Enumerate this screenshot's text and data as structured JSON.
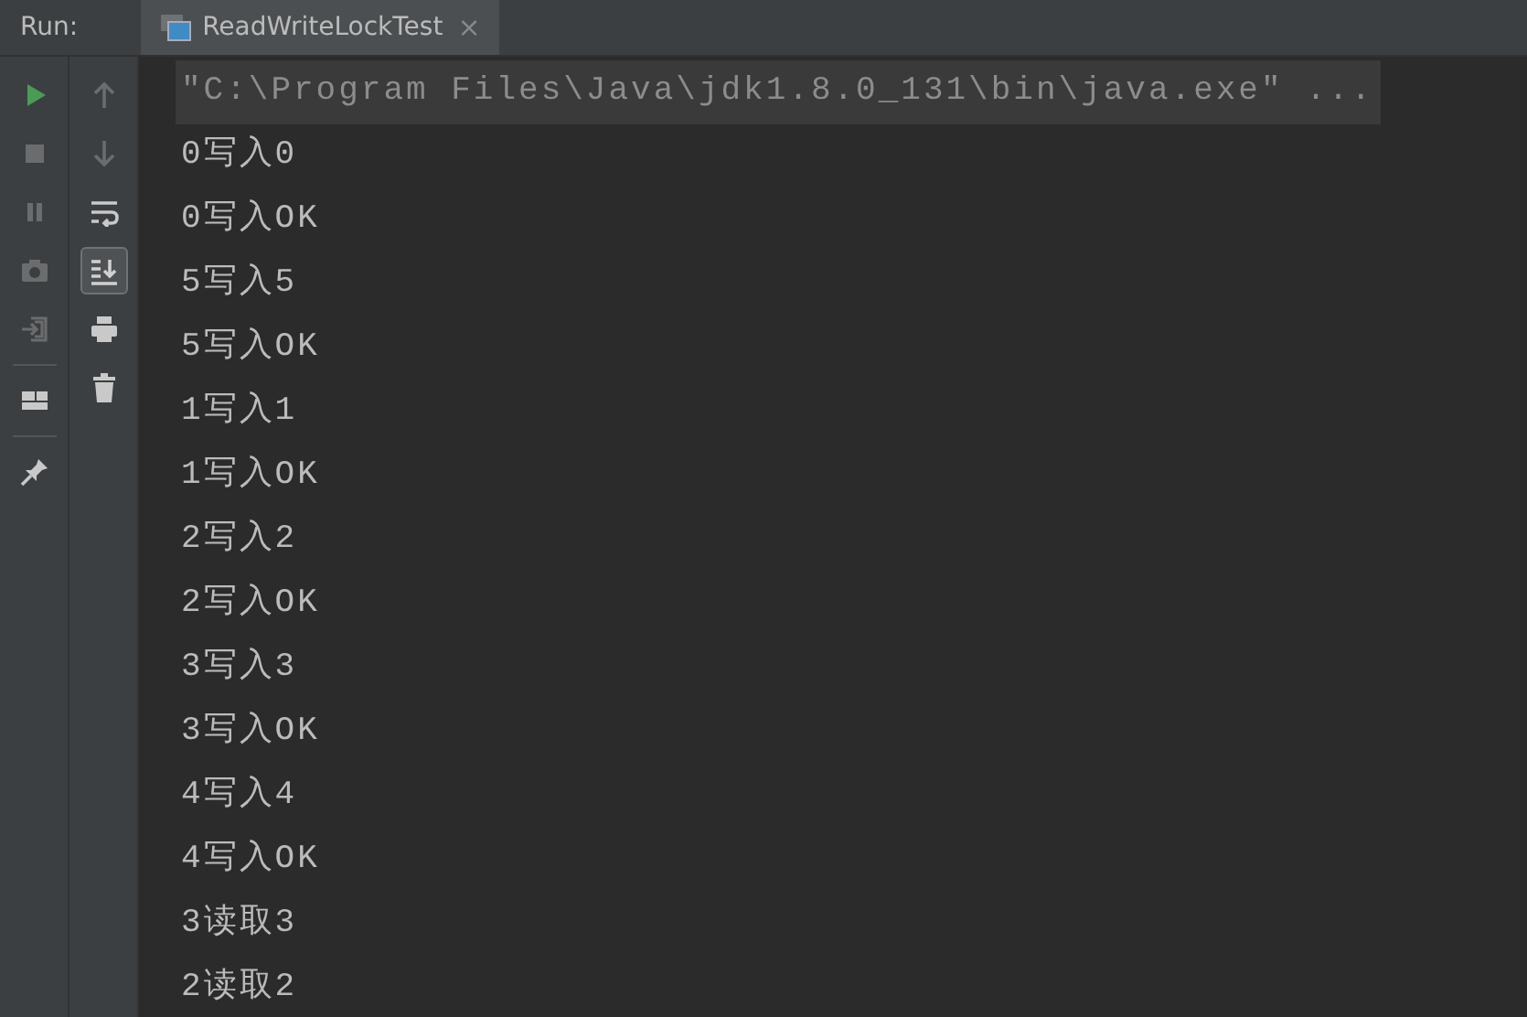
{
  "header": {
    "label": "Run:",
    "tab": {
      "title": "ReadWriteLockTest",
      "close": "×",
      "selected": true
    }
  },
  "toolbar_left": [
    {
      "kind": "run",
      "disabled": false
    },
    {
      "kind": "stop",
      "disabled": true
    },
    {
      "kind": "pause",
      "disabled": true
    },
    {
      "kind": "camera",
      "disabled": true
    },
    {
      "kind": "exit",
      "disabled": true
    },
    {
      "kind": "separator"
    },
    {
      "kind": "layout",
      "disabled": false
    },
    {
      "kind": "separator"
    },
    {
      "kind": "pin",
      "disabled": false
    }
  ],
  "toolbar_right": [
    {
      "kind": "up",
      "disabled": true,
      "selected": false
    },
    {
      "kind": "down",
      "disabled": true,
      "selected": false
    },
    {
      "kind": "wrap",
      "disabled": false,
      "selected": false
    },
    {
      "kind": "scroll-end",
      "disabled": false,
      "selected": true
    },
    {
      "kind": "print",
      "disabled": false,
      "selected": false
    },
    {
      "kind": "trash",
      "disabled": false,
      "selected": false
    }
  ],
  "console": {
    "command": "\"C:\\Program Files\\Java\\jdk1.8.0_131\\bin\\java.exe\" ...",
    "lines": [
      "0写入0",
      "0写入OK",
      "5写入5",
      "5写入OK",
      "1写入1",
      "1写入OK",
      "2写入2",
      "2写入OK",
      "3写入3",
      "3写入OK",
      "4写入4",
      "4写入OK",
      "3读取3",
      "2读取2"
    ]
  }
}
